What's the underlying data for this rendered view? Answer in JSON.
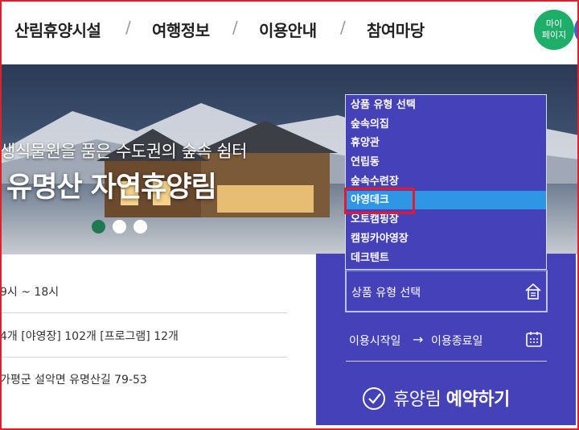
{
  "nav": {
    "items": [
      "산림휴양시설",
      "여행정보",
      "이용안내",
      "참여마당"
    ],
    "separator": "/",
    "mypage_line1": "마이",
    "mypage_line2": "페이지"
  },
  "hero": {
    "subtitle": "생식물원을 품은 수도권의 숲속 쉼터",
    "title": "유명산 자연휴양림",
    "slides": 3,
    "active_slide": 1
  },
  "info": {
    "hours": "9시 ~ 18시",
    "facilities": "4개 [야영장] 102개 [프로그램] 12개",
    "address": "가평군 설악면 유명산길 79-53"
  },
  "dropdown": {
    "items": [
      "상품 유형 선택",
      "숲속의집",
      "휴양관",
      "연립동",
      "숲속수련장",
      "야영데크",
      "오토캠핑장",
      "캠핑카야영장",
      "데크텐트"
    ],
    "highlighted_index": 5
  },
  "booking": {
    "type_select_value": "상품 유형 선택",
    "start_label": "이용시작일",
    "arrow": "→",
    "end_label": "이용종료일",
    "reserve_prefix": "휴양림",
    "reserve_bold": "예약하기"
  },
  "colors": {
    "panel": "#4441b9",
    "highlight": "#2f95e5",
    "annotation": "#e4182e",
    "mypage": "#1fae6a"
  }
}
